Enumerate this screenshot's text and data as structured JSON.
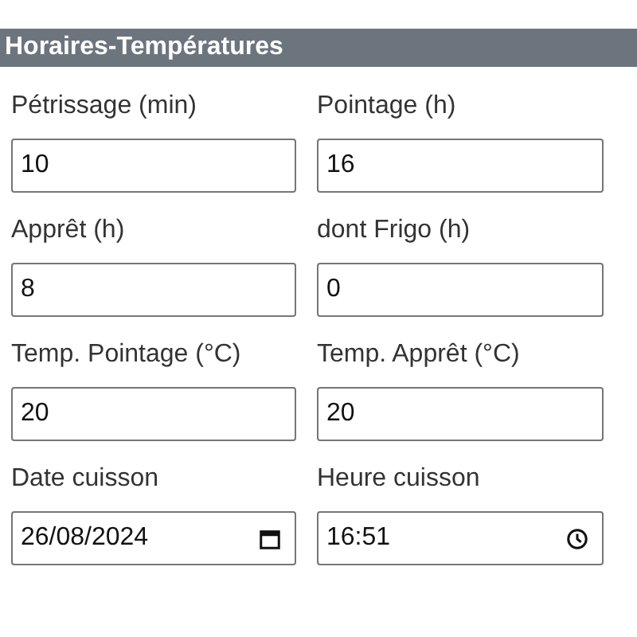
{
  "section": {
    "title": "Horaires-Températures"
  },
  "fields": [
    {
      "label": "Pétrissage (min)",
      "value": "10",
      "kind": "text"
    },
    {
      "label": "Pointage (h)",
      "value": "16",
      "kind": "text"
    },
    {
      "label": "Apprêt (h)",
      "value": "8",
      "kind": "text"
    },
    {
      "label": "dont Frigo (h)",
      "value": "0",
      "kind": "text"
    },
    {
      "label": "Temp. Pointage (°C)",
      "value": "20",
      "kind": "text"
    },
    {
      "label": "Temp. Apprêt (°C)",
      "value": "20",
      "kind": "text"
    },
    {
      "label": "Date cuisson",
      "value": "26/08/2024",
      "kind": "date"
    },
    {
      "label": "Heure cuisson",
      "value": "16:51",
      "kind": "time"
    }
  ]
}
